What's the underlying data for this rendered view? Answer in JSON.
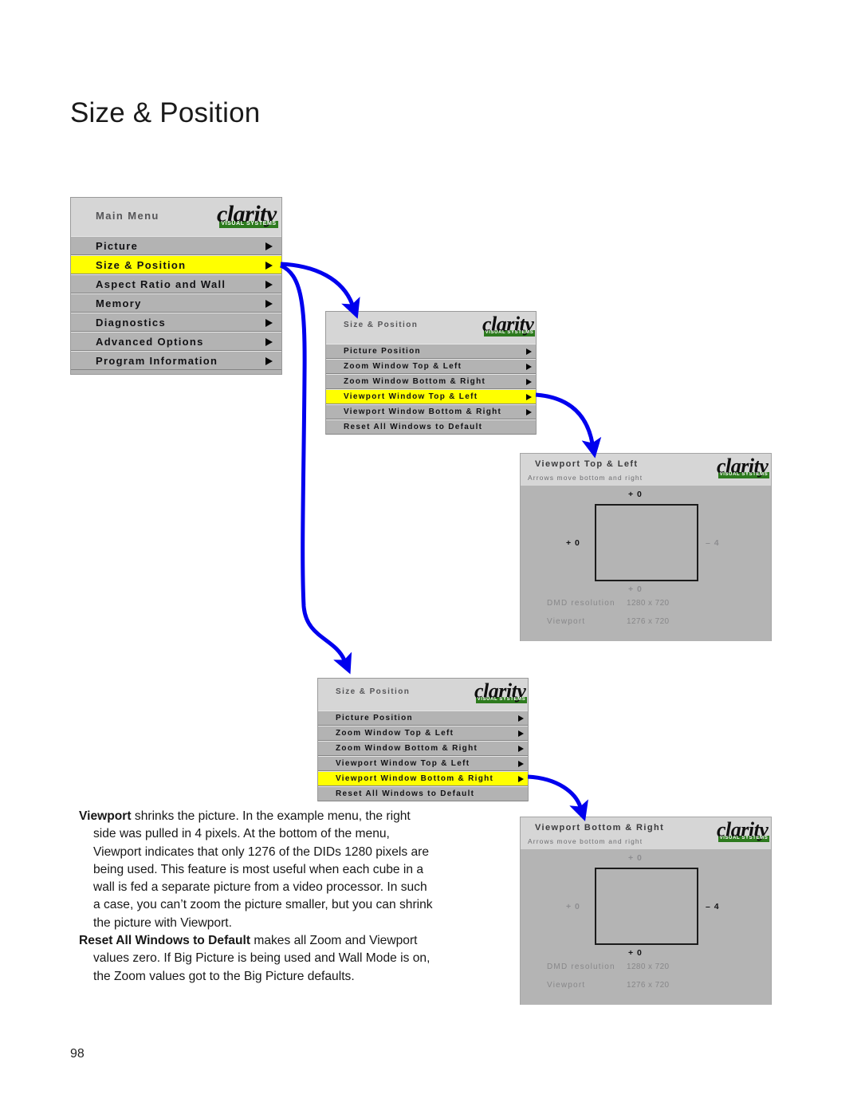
{
  "page": {
    "title": "Size & Position",
    "number": "98"
  },
  "logo": {
    "word": "clarity",
    "tagline": "VISUAL SYSTEMS"
  },
  "main_menu": {
    "title": "Main Menu",
    "items": [
      {
        "label": "Picture",
        "selected": false
      },
      {
        "label": "Size & Position",
        "selected": true
      },
      {
        "label": "Aspect Ratio and Wall",
        "selected": false
      },
      {
        "label": "Memory",
        "selected": false
      },
      {
        "label": "Diagnostics",
        "selected": false
      },
      {
        "label": "Advanced Options",
        "selected": false
      },
      {
        "label": "Program Information",
        "selected": false
      }
    ]
  },
  "size_position_menu_1": {
    "title": "Size & Position",
    "items": [
      {
        "label": "Picture Position",
        "selected": false,
        "arrow": true
      },
      {
        "label": "Zoom Window Top & Left",
        "selected": false,
        "arrow": true
      },
      {
        "label": "Zoom Window Bottom & Right",
        "selected": false,
        "arrow": true
      },
      {
        "label": "Viewport Window Top & Left",
        "selected": true,
        "arrow": true
      },
      {
        "label": "Viewport Window Bottom & Right",
        "selected": false,
        "arrow": true
      },
      {
        "label": "Reset All Windows to Default",
        "selected": false,
        "arrow": false
      }
    ]
  },
  "size_position_menu_2": {
    "title": "Size & Position",
    "items": [
      {
        "label": "Picture Position",
        "selected": false,
        "arrow": true
      },
      {
        "label": "Zoom Window Top & Left",
        "selected": false,
        "arrow": true
      },
      {
        "label": "Zoom Window Bottom & Right",
        "selected": false,
        "arrow": true
      },
      {
        "label": "Viewport Window Top & Left",
        "selected": false,
        "arrow": true
      },
      {
        "label": "Viewport Window Bottom & Right",
        "selected": true,
        "arrow": true
      },
      {
        "label": "Reset All Windows to Default",
        "selected": false,
        "arrow": false
      }
    ]
  },
  "viewport_top_left": {
    "title": "Viewport Top & Left",
    "subtitle": "Arrows move bottom and right",
    "values": {
      "top": {
        "text": "+ 0",
        "active": true
      },
      "left": {
        "text": "+ 0",
        "active": true
      },
      "right": {
        "text": "– 4",
        "active": false
      },
      "bottom": {
        "text": "+ 0",
        "active": false
      }
    },
    "stats": [
      {
        "key": "DMD resolution",
        "value": "1280 x 720"
      },
      {
        "key": "Viewport",
        "value": "1276 x 720"
      }
    ]
  },
  "viewport_bottom_right": {
    "title": "Viewport Bottom & Right",
    "subtitle": "Arrows move bottom and right",
    "values": {
      "top": {
        "text": "+ 0",
        "active": false
      },
      "left": {
        "text": "+ 0",
        "active": false
      },
      "right": {
        "text": "– 4",
        "active": true
      },
      "bottom": {
        "text": "+ 0",
        "active": true
      }
    },
    "stats": [
      {
        "key": "DMD resolution",
        "value": "1280 x 720"
      },
      {
        "key": "Viewport",
        "value": "1276 x 720"
      }
    ]
  },
  "body": {
    "paragraph_1_lead": "Viewport",
    "paragraph_1_rest": " shrinks the picture. In the example menu, the right side was pulled in 4 pixels. At the bottom of the menu, Viewport indicates that only 1276 of the DIDs 1280 pixels are being used. This feature is most useful when each cube in a wall is fed a separate picture from a video processor. In such a case, you can’t zoom the picture smaller, but you can shrink the picture with Viewport.",
    "paragraph_2_lead": "Reset All Windows to Default",
    "paragraph_2_rest": " makes all Zoom and Viewport values zero. If Big Picture is being used and Wall Mode is on, the Zoom values got to the Big Picture defaults."
  },
  "colors": {
    "highlight": "#ffff00",
    "arrow_blue": "#0000ee",
    "logo_green": "#2d7a1e",
    "panel_gray": "#b3b3b3",
    "header_gray": "#d6d6d6"
  }
}
